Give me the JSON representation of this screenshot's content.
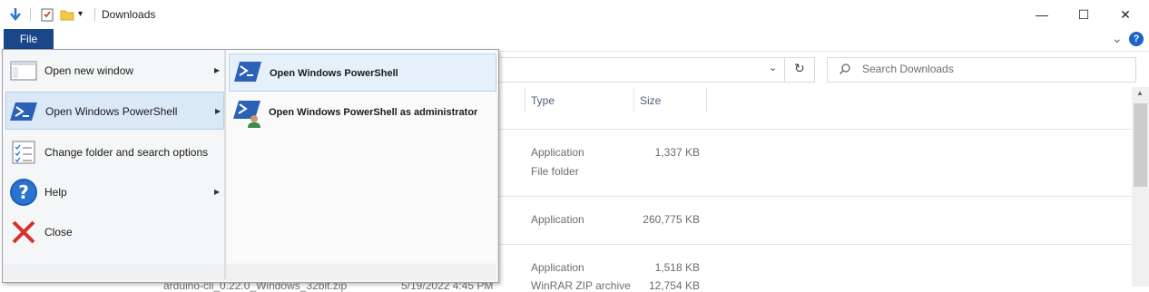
{
  "window": {
    "title": "Downloads",
    "minimize_glyph": "—",
    "maximize_glyph": "☐",
    "close_glyph": "✕"
  },
  "ribbon": {
    "file_tab": "File",
    "expand_glyph": "⌄",
    "help_glyph": "?"
  },
  "search": {
    "placeholder": "Search Downloads"
  },
  "columns": {
    "type": "Type",
    "size": "Size"
  },
  "rows": [
    {
      "type": "Application",
      "size": "1,337 KB"
    },
    {
      "type": "File folder",
      "size": ""
    },
    {
      "type": "Application",
      "size": "260,775 KB"
    },
    {
      "type": "Application",
      "size": "1,518 KB"
    },
    {
      "type": "WinRAR ZIP archive",
      "size": "12,754 KB",
      "name": "arduino-cli_0.22.0_Windows_32bit.zip",
      "date": "5/19/2022 4:45 PM"
    }
  ],
  "file_menu": {
    "items": [
      {
        "label": "Open new window",
        "has_submenu": true,
        "icon": "new-window-icon"
      },
      {
        "label": "Open Windows PowerShell",
        "has_submenu": true,
        "icon": "powershell-icon"
      },
      {
        "label": "Change folder and search options",
        "has_submenu": false,
        "icon": "folder-options-icon"
      },
      {
        "label": "Help",
        "has_submenu": true,
        "icon": "help-icon"
      },
      {
        "label": "Close",
        "has_submenu": false,
        "icon": "close-icon"
      }
    ],
    "submenu": [
      {
        "label": "Open Windows PowerShell",
        "icon": "powershell-icon"
      },
      {
        "label": "Open Windows PowerShell as administrator",
        "icon": "powershell-admin-icon"
      }
    ]
  },
  "colors": {
    "file_tab": "#19478a",
    "selected": "#dbe8f6",
    "powershell": "#2b62b8",
    "close_x": "#d8312b"
  }
}
